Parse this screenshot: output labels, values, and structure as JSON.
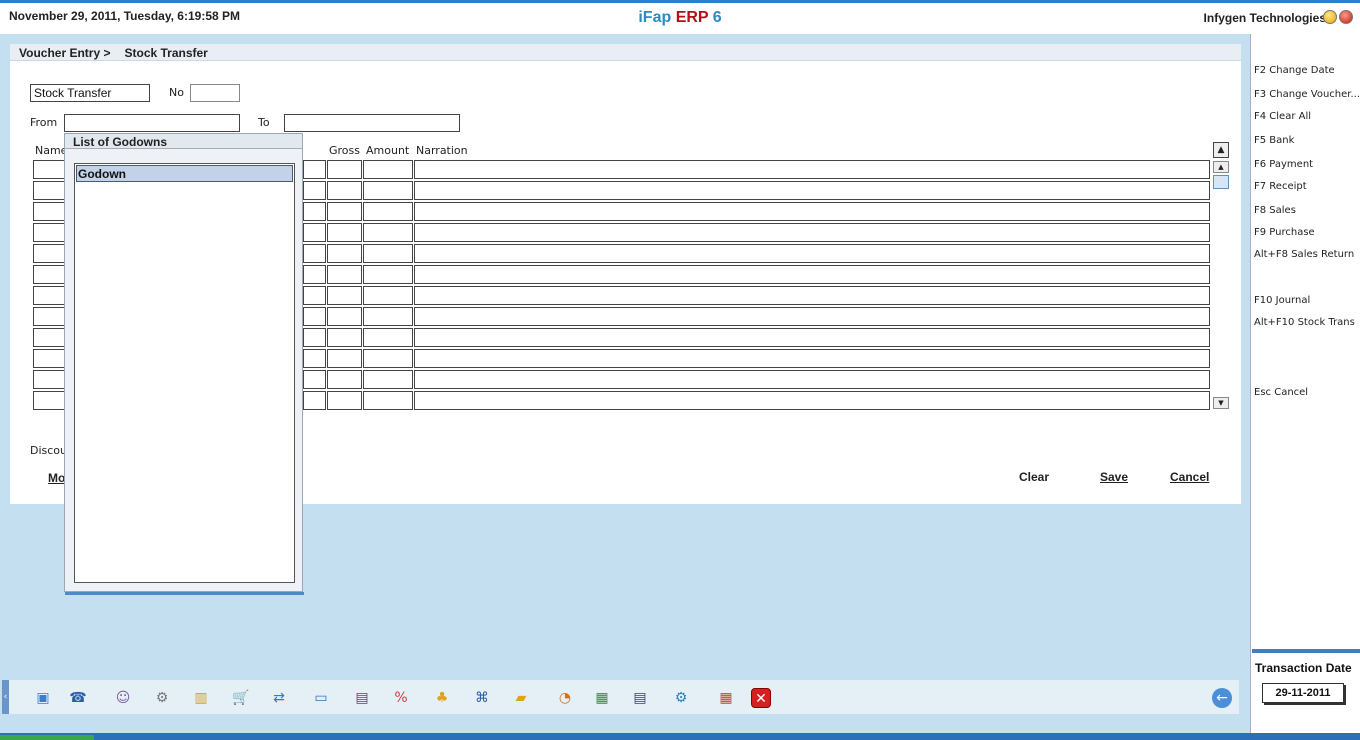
{
  "header": {
    "datetime": "November  29, 2011, Tuesday, 6:19:58 PM",
    "brand_a": "iFap",
    "brand_b": "ERP",
    "brand_c": "6",
    "company": "Infygen Technologies"
  },
  "breadcrumb": {
    "parent": "Voucher Entry >",
    "current": "Stock Transfer"
  },
  "form": {
    "voucher_type": "Stock Transfer",
    "no_label": "No",
    "no_value": "",
    "from_label": "From",
    "from_value": "",
    "to_label": "To",
    "to_value": ""
  },
  "grid": {
    "columns": {
      "name": "Name",
      "gross": "Gross",
      "amount": "Amount",
      "narration": "Narration"
    }
  },
  "footer_form": {
    "discount_partial": "Discou",
    "more_partial": "Mo",
    "clear": "Clear",
    "save": "Save",
    "cancel": "Cancel"
  },
  "popup": {
    "title": "List of Godowns",
    "items": [
      "Godown"
    ]
  },
  "shortcuts": [
    "F2 Change Date",
    "F3 Change Voucher...",
    "F4 Clear All",
    "F5 Bank",
    "F6 Payment",
    "F7 Receipt",
    "F8 Sales",
    "F9 Purchase",
    "Alt+F8 Sales Return",
    "F10 Journal",
    "Alt+F10 Stock Trans",
    "Esc Cancel"
  ],
  "transaction": {
    "label": "Transaction Date",
    "date": "29-11-2011"
  },
  "toolbar_icons": [
    "voucher-icon",
    "user-icon",
    "customer-icon",
    "settings-icon",
    "books-icon",
    "cart-icon",
    "transfer-icon",
    "window-icon",
    "report-icon",
    "discount-icon",
    "tree-icon",
    "network-icon",
    "package-icon",
    "chart-icon",
    "calculator-icon",
    "save-icon",
    "gear-icon",
    "calendar-icon",
    "close-icon",
    "back-icon"
  ]
}
